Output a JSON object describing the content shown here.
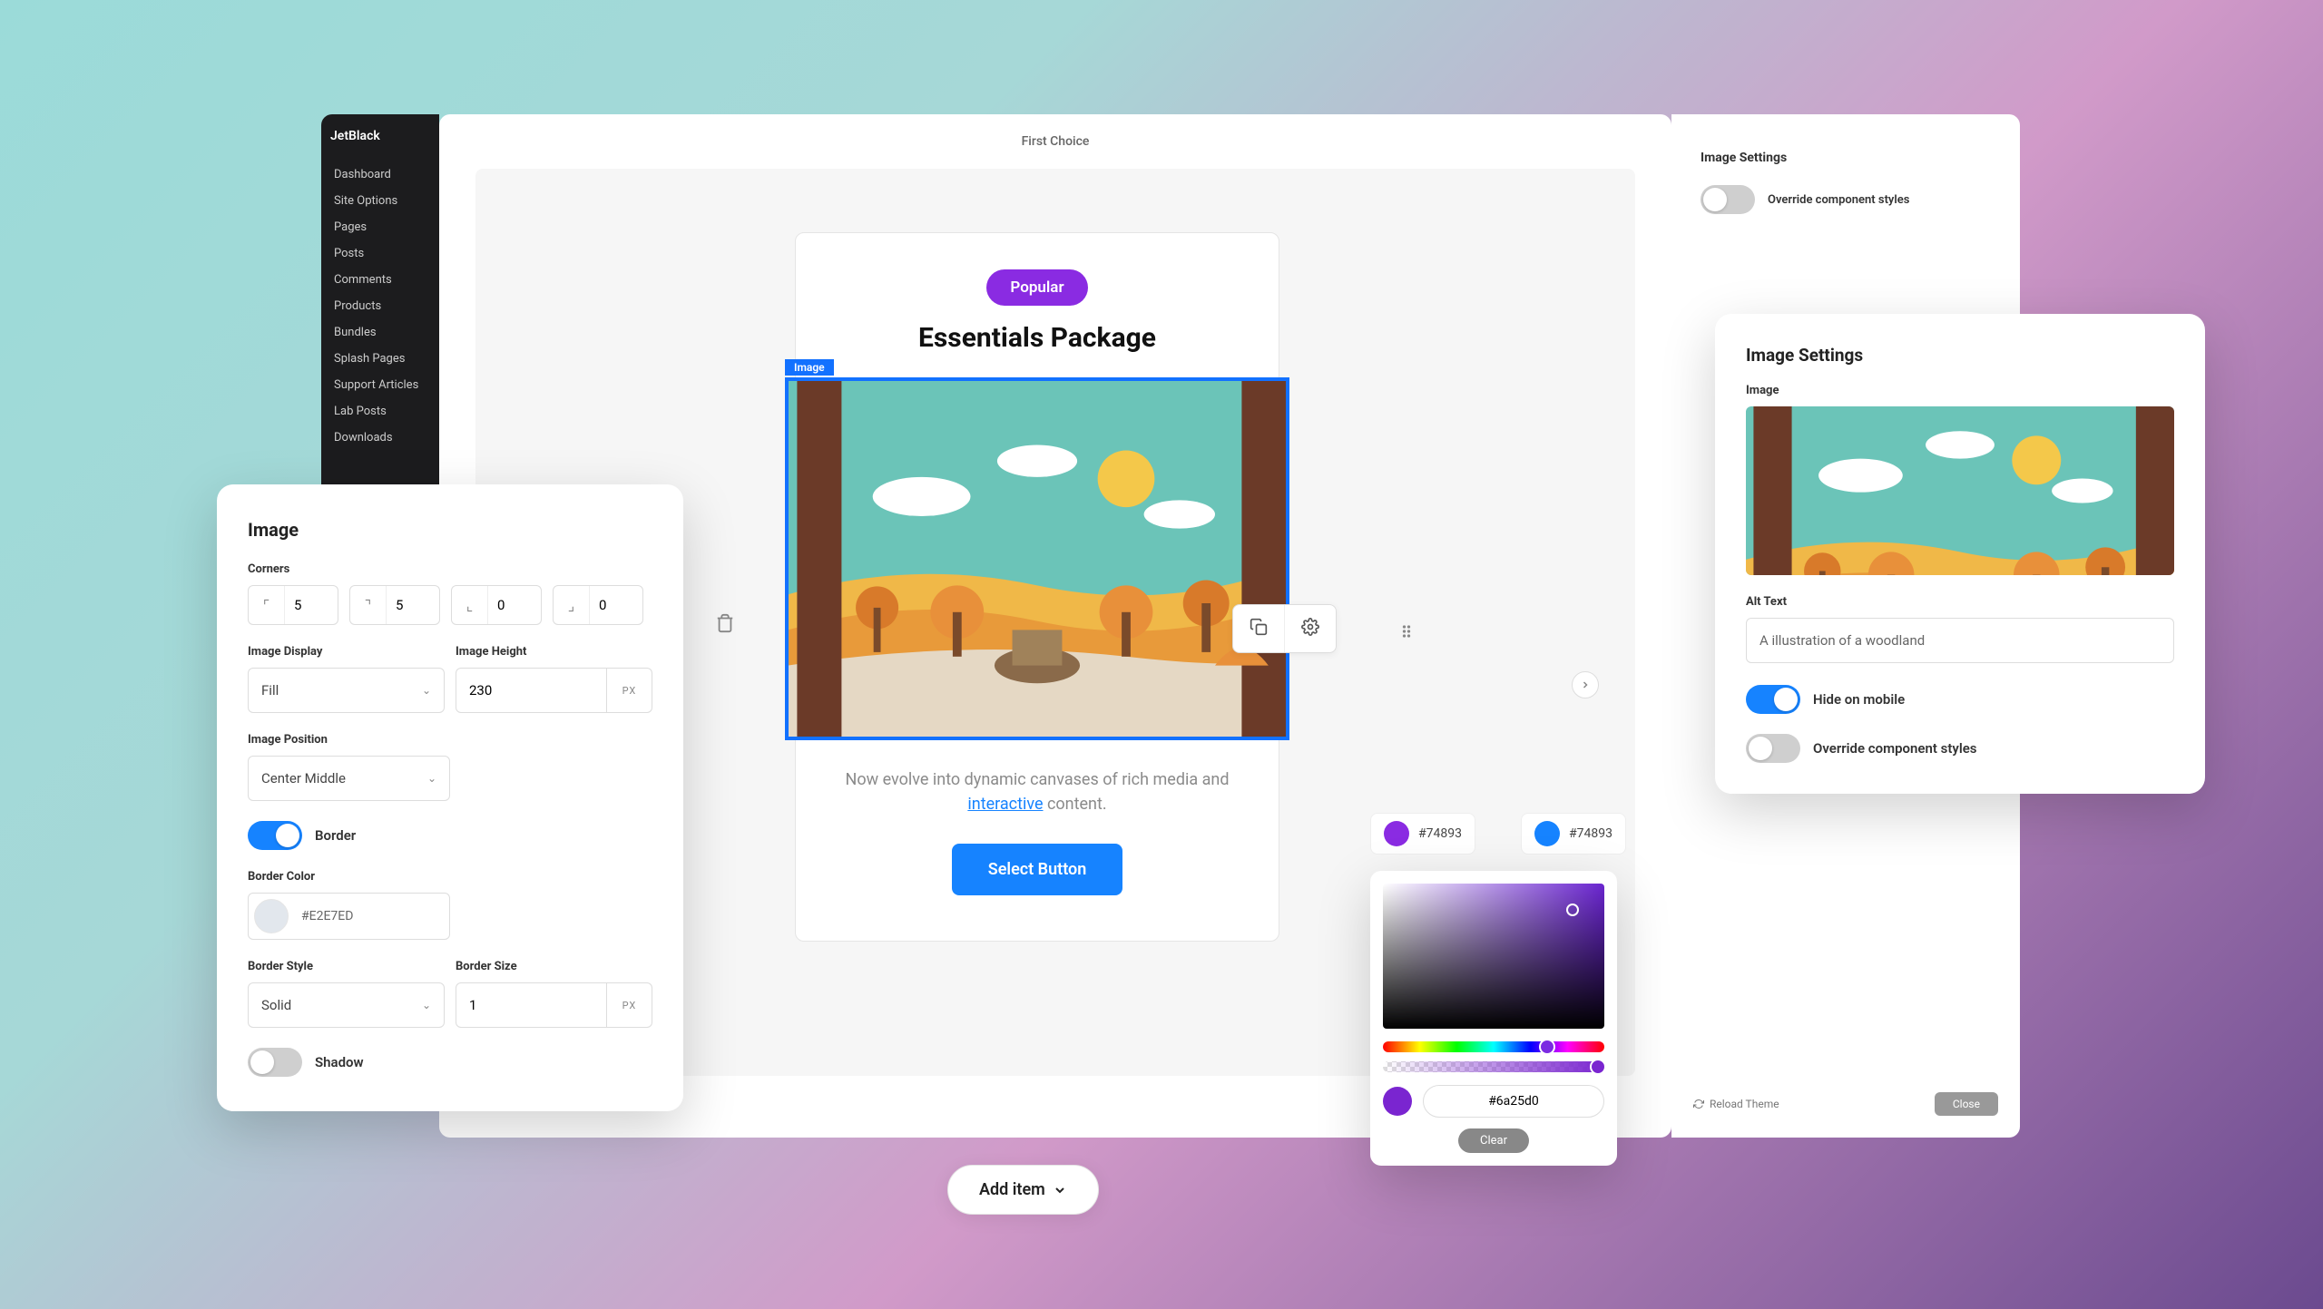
{
  "sidebar": {
    "brand": "JetBlack",
    "items": [
      "Dashboard",
      "Site Options",
      "Pages",
      "Posts",
      "Comments",
      "Products",
      "Bundles",
      "Splash Pages",
      "Support Articles",
      "Lab Posts",
      "Downloads"
    ]
  },
  "editor": {
    "tab_title": "First Choice",
    "card": {
      "badge": "Popular",
      "title": "Essentials Package",
      "image_tag": "Image",
      "desc_a": "Now evolve into dynamic canvases of rich media and ",
      "desc_link": "interactive",
      "desc_b": " content.",
      "button": "Select Button"
    },
    "add_item": "Add item"
  },
  "right_strip": {
    "title": "Image Settings",
    "override_label": "Override component styles",
    "reload": "Reload Theme",
    "close": "Close"
  },
  "image_panel": {
    "title": "Image",
    "corners_label": "Corners",
    "corners": [
      "5",
      "5",
      "0",
      "0"
    ],
    "image_display_label": "Image Display",
    "image_display": "Fill",
    "image_height_label": "Image Height",
    "image_height": "230",
    "image_height_unit": "PX",
    "image_position_label": "Image Position",
    "image_position": "Center Middle",
    "border_toggle_label": "Border",
    "border_color_label": "Border Color",
    "border_color": "#E2E7ED",
    "border_style_label": "Border Style",
    "border_style": "Solid",
    "border_size_label": "Border Size",
    "border_size": "1",
    "border_size_unit": "PX",
    "shadow_label": "Shadow"
  },
  "color_picker": {
    "chip1_hex": "#74893",
    "chip2_hex": "#74893",
    "hex": "#6a25d0",
    "clear": "Clear"
  },
  "settings_card": {
    "title": "Image Settings",
    "image_label": "Image",
    "alt_label": "Alt Text",
    "alt_value": "A illustration of a woodland",
    "hide_mobile": "Hide on mobile",
    "override": "Override component styles"
  },
  "colors": {
    "purple": "#8a2be2",
    "blue": "#1683ff",
    "swatch_border": "#E2E7ED"
  }
}
